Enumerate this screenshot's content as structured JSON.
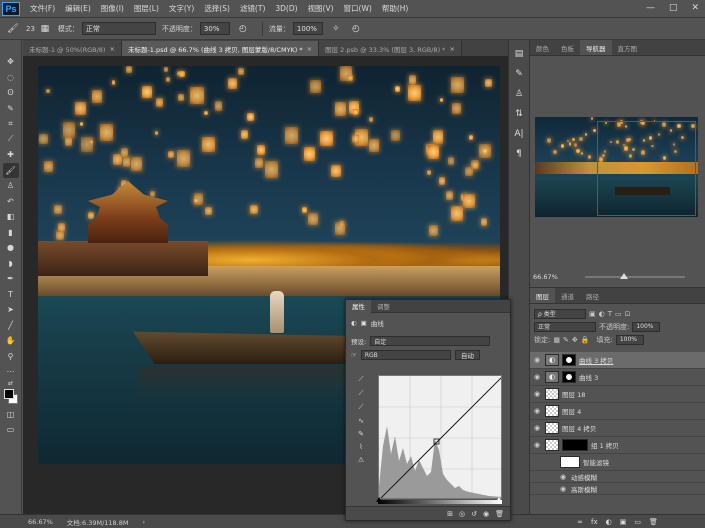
{
  "menubar": {
    "logo": "Ps",
    "items": [
      "文件(F)",
      "编辑(E)",
      "图像(I)",
      "图层(L)",
      "文字(Y)",
      "选择(S)",
      "滤镜(T)",
      "3D(D)",
      "视图(V)",
      "窗口(W)",
      "帮助(H)"
    ]
  },
  "window_controls": {
    "minimize": "—",
    "maximize": "□",
    "close": "✕"
  },
  "options": {
    "mode_label": "模式：",
    "mode_value": "正常",
    "opacity_label": "不透明度：",
    "opacity_value": "30%",
    "flow_label": "流量：",
    "flow_value": "100%",
    "brush_size": "23"
  },
  "tabs": [
    {
      "label": "未标题-1 @ 50%(RGB/8)",
      "active": false
    },
    {
      "label": "未标题-1.psd @ 66.7% (曲线 3 拷贝, 图层蒙版/8/CMYK) *",
      "active": true
    },
    {
      "label": "图层 2.psb @ 33.3% (图层 3, RGB/8) *",
      "active": false
    }
  ],
  "tab_close": "×",
  "status": {
    "zoom": "66.67%",
    "doc_info": "文档:6.39M/118.8M",
    "arrow": "›"
  },
  "top_panel": {
    "tabs": [
      "颜色",
      "色板",
      "导航器",
      "直方图"
    ],
    "active_tab": "导航器",
    "zoom": "66.67%"
  },
  "layers_panel": {
    "tabs": [
      "图层",
      "通道",
      "路径"
    ],
    "active_tab": "图层",
    "filter_label": "ρ 类型",
    "blend_mode": "正常",
    "opacity_label": "不透明度:",
    "opacity_value": "100%",
    "lock_label": "锁定:",
    "fill_label": "填充:",
    "fill_value": "100%",
    "layers": [
      {
        "name": "曲线 3 拷贝",
        "type": "adjust",
        "selected": true
      },
      {
        "name": "曲线 3",
        "type": "adjust",
        "selected": false
      },
      {
        "name": "图层 18",
        "type": "checker",
        "selected": false
      },
      {
        "name": "图层 4",
        "type": "checker",
        "selected": false
      },
      {
        "name": "图层 4 拷贝",
        "type": "checker",
        "selected": false
      },
      {
        "name": "组 1 拷贝",
        "type": "group",
        "selected": false
      },
      {
        "name": "智能滤镜",
        "type": "smart",
        "selected": false
      },
      {
        "name": "动感模糊",
        "type": "filter",
        "selected": false
      },
      {
        "name": "高斯模糊",
        "type": "filter",
        "selected": false
      }
    ],
    "footer_icons": [
      "∞",
      "fx",
      "◐",
      "▣",
      "▭",
      "🗑"
    ]
  },
  "properties": {
    "tabs": [
      "属性",
      "调整"
    ],
    "active_tab": "属性",
    "title": "曲线",
    "preset_label": "预设:",
    "preset_value": "自定",
    "channel_value": "RGB",
    "auto_label": "自动",
    "footer_icons": [
      "⊞",
      "◎",
      "↺",
      "◉",
      "🗑"
    ]
  },
  "colors": {
    "foreground": "#000000",
    "background": "#ffffff",
    "nav_box": "#e02020"
  }
}
